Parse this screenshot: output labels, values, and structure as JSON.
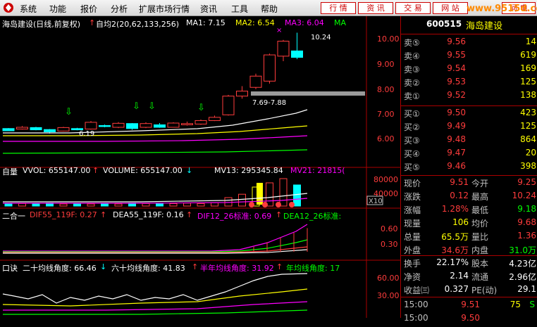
{
  "menu": {
    "items": [
      "系统",
      "功能",
      "报价",
      "分析",
      "扩展市场行情",
      "资讯",
      "工具",
      "帮助"
    ],
    "right_buttons": [
      "行 情",
      "资 讯",
      "交 易",
      "网 站",
      "问 电"
    ],
    "watermark": "www.9515d.com"
  },
  "kline": {
    "title": "海岛建设(日线,前复权)",
    "ma_label": "自均2(20,62,133,256)",
    "ma1": "MA1: 7.15",
    "ma2": "MA2: 6.54",
    "ma3": "MA3: 6.04",
    "ma_tail": "MA",
    "high_label": "10.24",
    "low_label": "6.19",
    "range_label": "7.69-7.88",
    "y_ticks": [
      "10.00",
      "9.00",
      "8.00",
      "7.00",
      "6.00"
    ],
    "colors": {
      "up": "#ff3c3c",
      "down": "#00ffff",
      "ma1": "#ffffff",
      "ma2": "#ffff00",
      "ma3": "#ff00ff",
      "ma4": "#00ff00"
    }
  },
  "volume": {
    "label": "自量",
    "vvol": "VVOL: 655147.00",
    "volume": "VOLUME: 655147.00",
    "mv13": "MV13: 295345.84",
    "mv21": "MV21: 21815(",
    "y_ticks": [
      "80000",
      "40000"
    ],
    "unit": "X10"
  },
  "macd": {
    "label": "二合一",
    "dif55": "DIF55_119F: 0.27",
    "dea55": "DEA55_119F: 0.16",
    "dif12": "DIF12_26标准: 0.69",
    "dea12": "DEA12_26标准:",
    "y_ticks": [
      "0.60",
      "0.30"
    ]
  },
  "angle": {
    "label": "口诀",
    "l20": "二十均线角度: 66.46",
    "l60": "六十均线角度: 41.83",
    "half": "半年均线角度: 31.92",
    "year": "年均线角度: 17",
    "y_ticks": [
      "60.00",
      "30.00"
    ]
  },
  "quote": {
    "code": "600515",
    "name": "海岛建设",
    "asks": [
      {
        "label": "卖⑤",
        "price": "9.56",
        "vol": "14"
      },
      {
        "label": "卖④",
        "price": "9.55",
        "vol": "619"
      },
      {
        "label": "卖③",
        "price": "9.54",
        "vol": "169"
      },
      {
        "label": "卖②",
        "price": "9.53",
        "vol": "125"
      },
      {
        "label": "卖①",
        "price": "9.52",
        "vol": "138"
      }
    ],
    "bids": [
      {
        "label": "买①",
        "price": "9.50",
        "vol": "423"
      },
      {
        "label": "买②",
        "price": "9.49",
        "vol": "125"
      },
      {
        "label": "买③",
        "price": "9.48",
        "vol": "864"
      },
      {
        "label": "买④",
        "price": "9.47",
        "vol": "20"
      },
      {
        "label": "买⑤",
        "price": "9.46",
        "vol": "398"
      }
    ],
    "stats": [
      {
        "l1": "现价",
        "v1": "9.51",
        "c1": "red",
        "l2": "今开",
        "v2": "9.25",
        "c2": "red"
      },
      {
        "l1": "涨跌",
        "v1": "0.12",
        "c1": "red",
        "l2": "最高",
        "v2": "10.24",
        "c2": "red"
      },
      {
        "l1": "涨幅",
        "v1": "1.28%",
        "c1": "red",
        "l2": "最低",
        "v2": "9.18",
        "c2": "green"
      },
      {
        "l1": "现量",
        "v1": "106",
        "c1": "yellow",
        "l2": "均价",
        "v2": "9.68",
        "c2": "red"
      },
      {
        "l1": "总量",
        "v1": "65.5万",
        "c1": "yellow",
        "l2": "量比",
        "v2": "1.36",
        "c2": "red"
      },
      {
        "l1": "外盘",
        "v1": "34.6万",
        "c1": "red",
        "l2": "内盘",
        "v2": "31.0万",
        "c2": "green"
      }
    ],
    "fund": [
      {
        "l1": "换手",
        "v1": "22.17%",
        "l2": "股本",
        "v2": "4.23亿"
      },
      {
        "l1": "净资",
        "v1": "2.14",
        "l2": "流通",
        "v2": "2.96亿"
      },
      {
        "l1": "收益㈢",
        "v1": "0.327",
        "l2": "PE(动)",
        "v2": "29.1"
      }
    ],
    "ticks": [
      {
        "time": "15:00",
        "price": "9.51",
        "vol": "75",
        "flag": "S"
      },
      {
        "time": "15:00",
        "price": "9.50",
        "vol": "",
        "flag": ""
      }
    ]
  }
}
